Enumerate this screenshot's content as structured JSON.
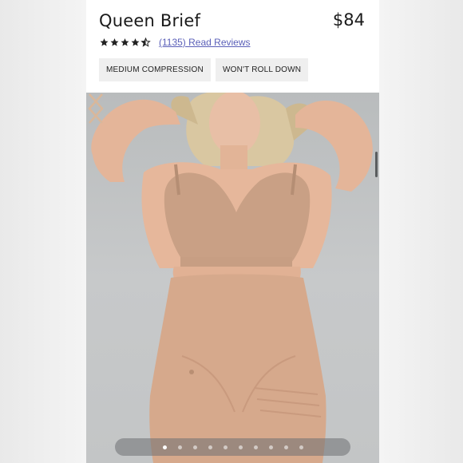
{
  "product": {
    "title": "Queen Brief",
    "price": "$84",
    "rating_stars": 4.5,
    "reviews_link": "(1135) Read Reviews"
  },
  "tags": [
    "MEDIUM COMPRESSION",
    "WON'T ROLL DOWN"
  ],
  "carousel": {
    "total_slides": 10,
    "active_slide": 1
  },
  "icons": {
    "prev": "chevron-left-icon",
    "next": "chevron-right-icon",
    "star": "star-icon"
  },
  "colors": {
    "accent_link": "#5a5fb8",
    "arrow": "#d9b79a",
    "tag_bg": "#efefef"
  }
}
